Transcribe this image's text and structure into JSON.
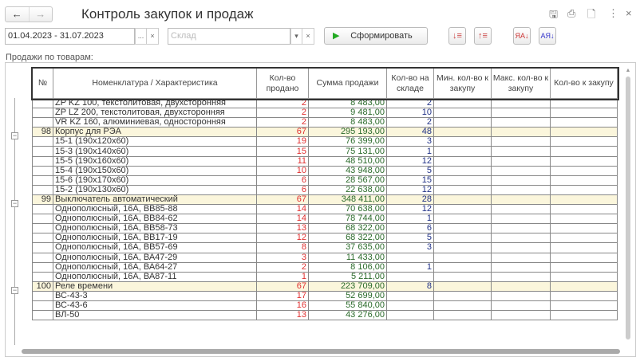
{
  "window": {
    "title": "Контроль закупок и продаж",
    "back": "←",
    "forward": "→"
  },
  "toolbar": {
    "period": "01.04.2023 - 31.07.2023",
    "period_btn": "...",
    "clear": "×",
    "warehouse_placeholder": "Склад",
    "dropdown": "▾",
    "generate": "Сформировать"
  },
  "section_label": "Продажи по товарам:",
  "columns": [
    "№",
    "Номенклатура / Характеристика",
    "Кол-во продано",
    "Сумма продажи",
    "Кол-во на складе",
    "Мин. кол-во к закупу",
    "Макс. кол-во к закупу",
    "Кол-во к закупу"
  ],
  "rows": [
    {
      "no": "",
      "name": "ZP KZ 100, текстолитовая, двухсторонняя",
      "qty": "2",
      "sum": "8 483,00",
      "stock": "2"
    },
    {
      "no": "",
      "name": "ZP LZ 200, текстолитовая, двухсторонняя",
      "qty": "2",
      "sum": "9 481,00",
      "stock": "10"
    },
    {
      "no": "",
      "name": "VR KZ 160, алюминиевая, односторонняя",
      "qty": "2",
      "sum": "8 483,00",
      "stock": "2"
    },
    {
      "no": "98",
      "name": "Корпус для РЭА",
      "qty": "67",
      "sum": "295 193,00",
      "stock": "48",
      "group": true
    },
    {
      "no": "",
      "name": "15-1 (190x120x60)",
      "qty": "19",
      "sum": "76 399,00",
      "stock": "3"
    },
    {
      "no": "",
      "name": "15-3 (190x140x60)",
      "qty": "15",
      "sum": "75 131,00",
      "stock": "1"
    },
    {
      "no": "",
      "name": "15-5 (190x160x60)",
      "qty": "11",
      "sum": "48 510,00",
      "stock": "12"
    },
    {
      "no": "",
      "name": "15-4 (190x150x60)",
      "qty": "10",
      "sum": "43 948,00",
      "stock": "5"
    },
    {
      "no": "",
      "name": "15-6 (190x170x60)",
      "qty": "6",
      "sum": "28 567,00",
      "stock": "15"
    },
    {
      "no": "",
      "name": "15-2 (190x130x60)",
      "qty": "6",
      "sum": "22 638,00",
      "stock": "12"
    },
    {
      "no": "99",
      "name": "Выключатель автоматический",
      "qty": "67",
      "sum": "348 411,00",
      "stock": "28",
      "group": true
    },
    {
      "no": "",
      "name": "Однополюсный, 16А, ВВ85-88",
      "qty": "14",
      "sum": "70 638,00",
      "stock": "12"
    },
    {
      "no": "",
      "name": "Однополюсный, 16А, ВВ84-62",
      "qty": "14",
      "sum": "78 744,00",
      "stock": "1"
    },
    {
      "no": "",
      "name": "Однополюсный, 16А, ВВ58-73",
      "qty": "13",
      "sum": "68 322,00",
      "stock": "6"
    },
    {
      "no": "",
      "name": "Однополюсный, 16А, ВВ17-19",
      "qty": "12",
      "sum": "68 322,00",
      "stock": "5"
    },
    {
      "no": "",
      "name": "Однополюсный, 16А, ВВ57-69",
      "qty": "8",
      "sum": "37 635,00",
      "stock": "3"
    },
    {
      "no": "",
      "name": "Однополюсный, 16А, ВА47-29",
      "qty": "3",
      "sum": "11 433,00",
      "stock": ""
    },
    {
      "no": "",
      "name": "Однополюсный, 16А, ВА64-27",
      "qty": "2",
      "sum": "8 106,00",
      "stock": "1"
    },
    {
      "no": "",
      "name": "Однополюсный, 16А, ВА87-11",
      "qty": "1",
      "sum": "5 211,00",
      "stock": ""
    },
    {
      "no": "100",
      "name": "Реле времени",
      "qty": "67",
      "sum": "223 709,00",
      "stock": "8",
      "group": true
    },
    {
      "no": "",
      "name": "ВС-43-3",
      "qty": "17",
      "sum": "52 699,00",
      "stock": ""
    },
    {
      "no": "",
      "name": "ВС-43-6",
      "qty": "16",
      "sum": "55 840,00",
      "stock": ""
    },
    {
      "no": "",
      "name": "ВЛ-50",
      "qty": "13",
      "sum": "43 276,00",
      "stock": ""
    }
  ]
}
